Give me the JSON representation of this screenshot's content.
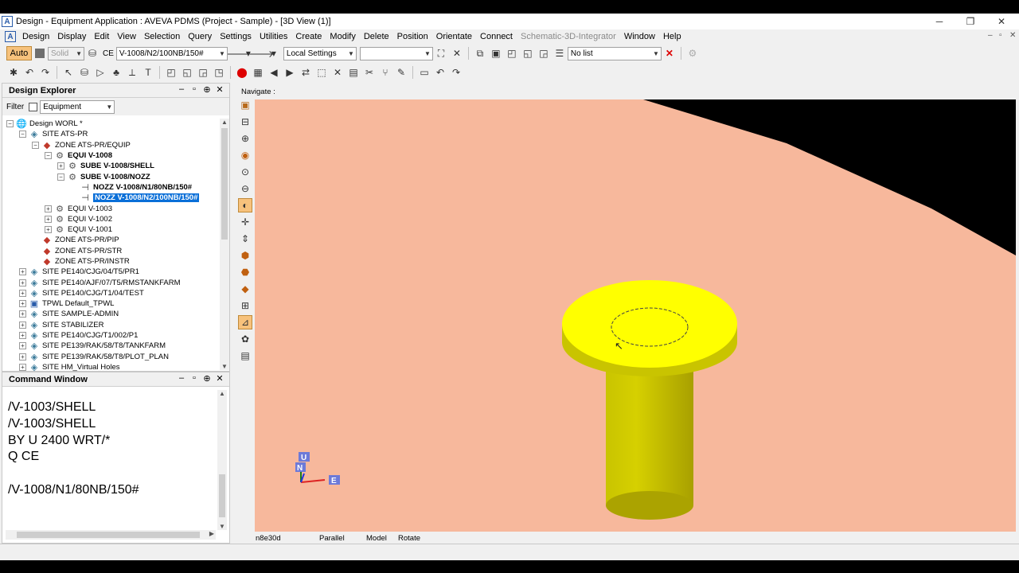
{
  "window": {
    "title": "Design - Equipment Application : AVEVA PDMS (Project - Sample) - [3D View (1)]",
    "app_icon": "A",
    "controls": [
      "─",
      "❐",
      "✕"
    ]
  },
  "menu": {
    "items": [
      "Design",
      "Display",
      "Edit",
      "View",
      "Selection",
      "Query",
      "Settings",
      "Utilities",
      "Create",
      "Modify",
      "Delete",
      "Position",
      "Orientate",
      "Connect",
      "Schematic-3D-Integrator",
      "Window",
      "Help"
    ],
    "disabled_item": "Schematic-3D-Integrator",
    "mdi_controls": [
      "–",
      "▫",
      "✕"
    ]
  },
  "toolbar1": {
    "auto_label": "Auto",
    "solid_label": "Solid",
    "ce_label": "CE",
    "ce_value": "V-1008/N2/100NB/150#",
    "settings_value": "Local Settings",
    "empty_combo_value": "",
    "list_value": "No list"
  },
  "design_explorer": {
    "title": "Design Explorer",
    "filter_label": "Filter",
    "filter_value": "Equipment",
    "tree": [
      {
        "level": 0,
        "exp": "⊟",
        "icon": "world-icon",
        "text": "Design WORL *",
        "style": ""
      },
      {
        "level": 1,
        "exp": "⊟",
        "icon": "site-icon",
        "text": "SITE ATS-PR",
        "style": ""
      },
      {
        "level": 2,
        "exp": "⊟",
        "icon": "zone-icon",
        "text": "ZONE ATS-PR/EQUIP",
        "style": ""
      },
      {
        "level": 3,
        "exp": "⊟",
        "icon": "equipment-icon",
        "text": "EQUI V-1008",
        "style": "bold"
      },
      {
        "level": 4,
        "exp": "⊞",
        "icon": "equipment-icon",
        "text": "SUBE V-1008/SHELL",
        "style": "bold"
      },
      {
        "level": 4,
        "exp": "⊟",
        "icon": "equipment-icon",
        "text": "SUBE V-1008/NOZZ",
        "style": "bold"
      },
      {
        "level": 5,
        "exp": "",
        "icon": "nozzle-icon",
        "text": "NOZZ V-1008/N1/80NB/150#",
        "style": "bold"
      },
      {
        "level": 5,
        "exp": "",
        "icon": "nozzle-icon",
        "text": "NOZZ V-1008/N2/100NB/150#",
        "style": "sel"
      },
      {
        "level": 3,
        "exp": "⊞",
        "icon": "equipment-icon",
        "text": "EQUI V-1003",
        "style": ""
      },
      {
        "level": 3,
        "exp": "⊞",
        "icon": "equipment-icon",
        "text": "EQUI V-1002",
        "style": ""
      },
      {
        "level": 3,
        "exp": "⊞",
        "icon": "equipment-icon",
        "text": "EQUI V-1001",
        "style": ""
      },
      {
        "level": 2,
        "exp": "",
        "icon": "zone-icon",
        "text": "ZONE ATS-PR/PIP",
        "style": ""
      },
      {
        "level": 2,
        "exp": "",
        "icon": "zone-icon",
        "text": "ZONE ATS-PR/STR",
        "style": ""
      },
      {
        "level": 2,
        "exp": "",
        "icon": "zone-icon",
        "text": "ZONE ATS-PR/INSTR",
        "style": ""
      },
      {
        "level": 1,
        "exp": "⊞",
        "icon": "site-icon",
        "text": "SITE PE140/CJG/04/T5/PR1",
        "style": ""
      },
      {
        "level": 1,
        "exp": "⊞",
        "icon": "site-icon",
        "text": "SITE PE140/AJF/07/T5/RMSTANKFARM",
        "style": ""
      },
      {
        "level": 1,
        "exp": "⊞",
        "icon": "site-icon",
        "text": "SITE PE140/CJG/T1/04/TEST",
        "style": ""
      },
      {
        "level": 1,
        "exp": "⊞",
        "icon": "tpwl-icon",
        "text": "TPWL Default_TPWL",
        "style": ""
      },
      {
        "level": 1,
        "exp": "⊞",
        "icon": "site-icon",
        "text": "SITE SAMPLE-ADMIN",
        "style": ""
      },
      {
        "level": 1,
        "exp": "⊞",
        "icon": "site-icon",
        "text": "SITE STABILIZER",
        "style": ""
      },
      {
        "level": 1,
        "exp": "⊞",
        "icon": "site-icon",
        "text": "SITE PE140/CJG/T1/002/P1",
        "style": ""
      },
      {
        "level": 1,
        "exp": "⊞",
        "icon": "site-icon",
        "text": "SITE PE139/RAK/58/T8/TANKFARM",
        "style": ""
      },
      {
        "level": 1,
        "exp": "⊞",
        "icon": "site-icon",
        "text": "SITE PE139/RAK/58/T8/PLOT_PLAN",
        "style": ""
      },
      {
        "level": 1,
        "exp": "⊞",
        "icon": "site-icon",
        "text": "SITE HM_Virtual Holes",
        "style": ""
      }
    ]
  },
  "command_window": {
    "title": "Command Window",
    "lines": [
      "/V-1003/SHELL",
      "/V-1003/SHELL",
      "BY U 2400 WRT/*",
      "Q CE",
      "",
      "/V-1008/N1/80NB/150#"
    ]
  },
  "view3d": {
    "navigate_label": "Navigate :",
    "axis_u": "U",
    "axis_n": "N",
    "axis_e": "E",
    "status": [
      "n8e30d",
      "Parallel",
      "Model",
      "Rotate"
    ],
    "colors": {
      "ground": "#f7b89c",
      "background": "#000000",
      "nozzle": "#ffff00"
    }
  }
}
